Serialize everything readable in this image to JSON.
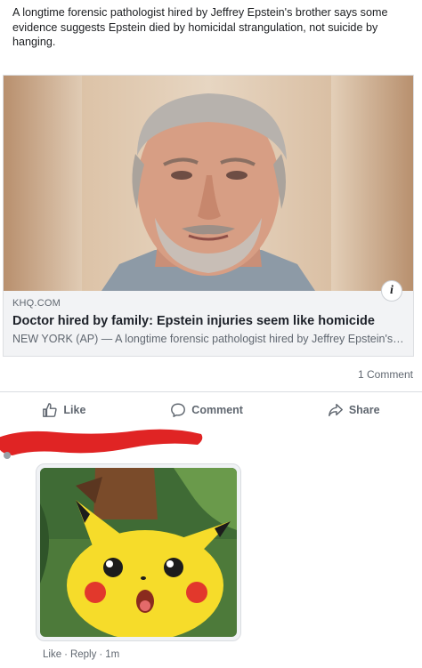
{
  "post": {
    "text": "A longtime forensic pathologist hired by Jeffrey Epstein's brother says some evidence suggests Epstein died by homicidal strangulation, not suicide by hanging."
  },
  "link_card": {
    "domain": "KHQ.COM",
    "title": "Doctor hired by family: Epstein injuries seem like homicide",
    "description": "NEW YORK (AP) — A longtime forensic pathologist hired by Jeffrey Epstein's brother says some evidence suggests Epstein died by homicidal strangulation",
    "info_icon": "info-icon"
  },
  "stats": {
    "comments": "1 Comment"
  },
  "actions": {
    "like": "Like",
    "comment": "Comment",
    "share": "Share"
  },
  "comment": {
    "like": "Like",
    "reply": "Reply",
    "time": "1m"
  },
  "colors": {
    "redaction": "#e02424",
    "meta_text": "#606770",
    "pikachu": "#f6dc2a"
  }
}
